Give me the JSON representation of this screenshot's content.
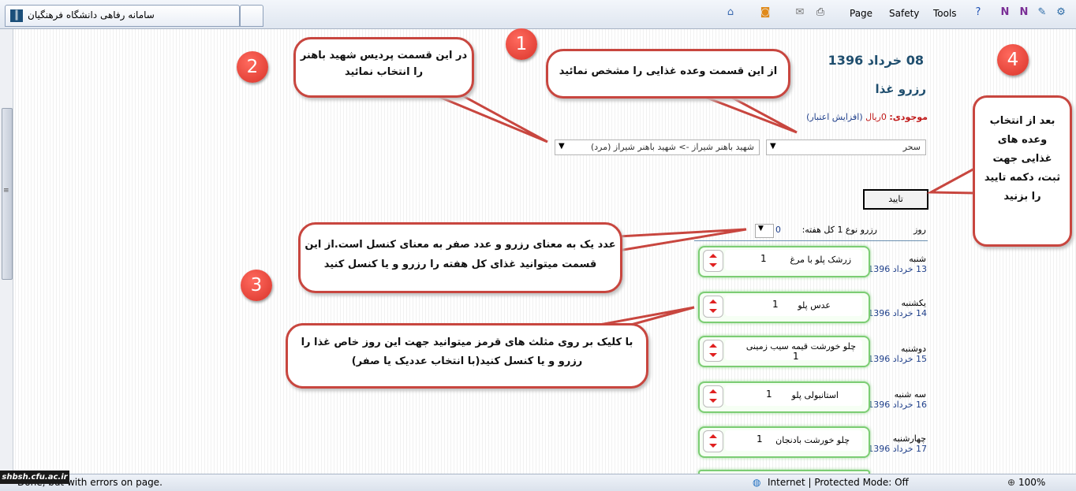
{
  "browser": {
    "tab_title": "سامانه رفاهی دانشگاه فرهنگیان",
    "menu": {
      "page": "Page",
      "safety": "Safety",
      "tools": "Tools"
    },
    "status_left": "Done, but with errors on page.",
    "zone": "Internet | Protected Mode: Off",
    "zoom": "100%",
    "watermark": "shbsh.cfu.ac.ir"
  },
  "page": {
    "date_title": "08 خرداد 1396",
    "heading": "رزرو غذا",
    "balance_label": "موجودی:",
    "balance_value": "0ریال",
    "add_credit": "(افزایش اعتبار)",
    "meal_select": "سحر",
    "campus_select": "شهید باهنر شیراز -> شهید باهنر شیراز (مرد)",
    "confirm_label": "تایید",
    "table_day_header": "روز",
    "table_week_header": "رزرو نوع 1 کل هفته:",
    "week_value": "0"
  },
  "days": [
    {
      "name": "شنبه",
      "date": "13 خرداد 1396",
      "meal": "زرشک پلو با مرغ",
      "count": "1"
    },
    {
      "name": "یکشنبه",
      "date": "14 خرداد 1396",
      "meal": "عدس پلو",
      "count": "1"
    },
    {
      "name": "دوشنبه",
      "date": "15 خرداد 1396",
      "meal": "چلو خورشت قیمه سیب زمینی",
      "count": "1"
    },
    {
      "name": "سه شنبه",
      "date": "16 خرداد 1396",
      "meal": "استانبولی پلو",
      "count": "1"
    },
    {
      "name": "چهارشنبه",
      "date": "17 خرداد 1396",
      "meal": "چلو خورشت بادنجان",
      "count": "1"
    }
  ],
  "callouts": {
    "c1": "از این قسمت وعده غذایی را مشخص نمائید",
    "c2_line1": "در این قسمت پردیس شهید باهنر",
    "c2_line2": "را انتخاب نمائید",
    "c4_line1": "بعد از انتخاب",
    "c4_line2": "وعده های",
    "c4_line3": "غذایی جهت",
    "c4_line4": "ثبت، دکمه تایید",
    "c4_line5": "را بزنید",
    "c3a_line1": "عدد یک به معنای رزرو و عدد صفر به معنای کنسل است.از این",
    "c3a_line2": "قسمت میتوانید غذای کل هفته را رزرو و یا کنسل کنید",
    "c3b_line1": "با کلیک بر روی مثلث های قرمز میتوانید جهت این روز خاص غذا را",
    "c3b_line2": "رزرو و یا کنسل کنید(با انتخاب عددیک یا صفر)"
  },
  "badges": {
    "b1": "1",
    "b2": "2",
    "b3": "3",
    "b4": "4"
  },
  "colors": {
    "callout_border": "#c8463f",
    "badge": "#e0392e",
    "meal_border": "#7ccd74",
    "title": "#1f4e6e"
  }
}
